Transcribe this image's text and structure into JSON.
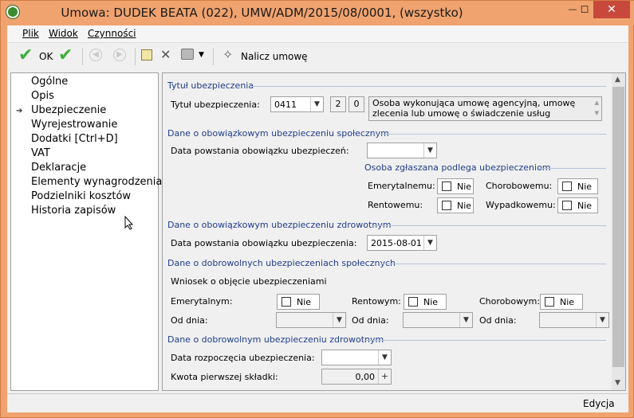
{
  "window": {
    "title": "Umowa: DUDEK BEATA (022), UMW/ADM/2015/08/0001, (wszystko)",
    "accent": "#f0a36f",
    "minimize": "—",
    "maximize": "◻",
    "close": "✕"
  },
  "menu": {
    "items": [
      {
        "label": "Plik"
      },
      {
        "label": "Widok"
      },
      {
        "label": "Czynności"
      }
    ]
  },
  "toolbar": {
    "ok_label": "OK",
    "compute_label": "Nalicz umowę"
  },
  "nav": {
    "items": [
      {
        "label": "Ogólne"
      },
      {
        "label": "Opis"
      },
      {
        "label": "Ubezpieczenie"
      },
      {
        "label": "Wyrejestrowanie"
      },
      {
        "label": "Dodatki [Ctrl+D]"
      },
      {
        "label": "VAT"
      },
      {
        "label": "Deklaracje"
      },
      {
        "label": "Elementy wynagrodzenia"
      },
      {
        "label": "Podzielniki kosztów"
      },
      {
        "label": "Historia zapisów"
      }
    ],
    "selected_index": 2
  },
  "form": {
    "sec_tytul": "Tytuł ubezpieczenia",
    "tytul_label": "Tytuł ubezpieczenia:",
    "tytul_code": "0411",
    "tytul_n1": "2",
    "tytul_n2": "0",
    "tytul_desc": "Osoba wykonująca umowę agencyjną, umowę zlecenia lub umowę o świadczenie usług",
    "sec_obow_spol": "Dane o obowiązkowym ubezpieczeniu społecznym",
    "data_obow_spol_label": "Data powstania obowiązku ubezpieczeń:",
    "data_obow_spol_value": "",
    "osoba_header": "Osoba zgłaszana podlega ubezpieczeniom",
    "emerytalnemu_label": "Emerytalnemu:",
    "emerytalnemu_value": "Nie",
    "chorobowemu_label": "Chorobowemu:",
    "chorobowemu_value": "Nie",
    "rentowemu_label": "Rentowemu:",
    "rentowemu_value": "Nie",
    "wypadkowemu_label": "Wypadkowemu:",
    "wypadkowemu_value": "Nie",
    "sec_obow_zdrow": "Dane o obowiązkowym ubezpieczeniu zdrowotnym",
    "data_obow_zdrow_label": "Data powstania obowiązku ubezpieczenia:",
    "data_obow_zdrow_value": "2015-08-01",
    "sec_dobr_spol": "Dane o dobrowolnych ubezpieczeniach społecznych",
    "wniosek_label": "Wniosek o objęcie ubezpieczeniami",
    "emerytalnym_label": "Emerytalnym:",
    "emerytalnym_value": "Nie",
    "rentowym_label": "Rentowym:",
    "rentowym_value": "Nie",
    "chorobowym_label": "Chorobowym:",
    "chorobowym_value": "Nie",
    "od_dnia_label": "Od dnia:",
    "sec_dobr_zdrow": "Dane o dobrowolnym ubezpieczeniu zdrowotnym",
    "data_rozp_label": "Data rozpoczęcia ubezpieczenia:",
    "data_rozp_value": "",
    "kwota_label": "Kwota pierwszej składki:",
    "kwota_value": "0,00"
  },
  "status": {
    "mode": "Edycja"
  }
}
